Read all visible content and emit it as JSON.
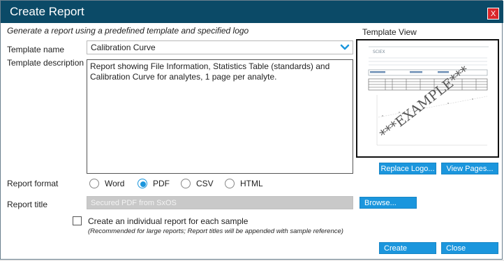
{
  "dialog": {
    "title": "Create Report",
    "close_label": "X",
    "subtitle": "Generate a report using a predefined template and specified logo"
  },
  "template": {
    "name_label": "Template name",
    "name_value": "Calibration Curve",
    "description_label": "Template description",
    "description_value": "Report showing File Information, Statistics Table (standards) and Calibration Curve for analytes, 1 page per analyte."
  },
  "template_view": {
    "label": "Template View",
    "watermark": "***EXAMPLE***",
    "logo_text": "SCIEX",
    "replace_logo_label": "Replace Logo...",
    "view_pages_label": "View Pages..."
  },
  "report_format": {
    "label": "Report format",
    "options": [
      "Word",
      "PDF",
      "CSV",
      "HTML"
    ],
    "selected": "PDF"
  },
  "report_title": {
    "label": "Report title",
    "placeholder": "Secured PDF from SxOS",
    "browse_label": "Browse..."
  },
  "individual": {
    "label": "Create an individual report for each sample",
    "note": "(Recommended for large reports; Report titles will be appended with sample reference)",
    "checked": false
  },
  "actions": {
    "create_label": "Create",
    "close_label": "Close"
  },
  "colors": {
    "titlebar": "#0b4a67",
    "accent": "#1b96dd",
    "close": "#d9262a"
  },
  "icons": [
    "close-icon",
    "chevron-down-icon"
  ]
}
